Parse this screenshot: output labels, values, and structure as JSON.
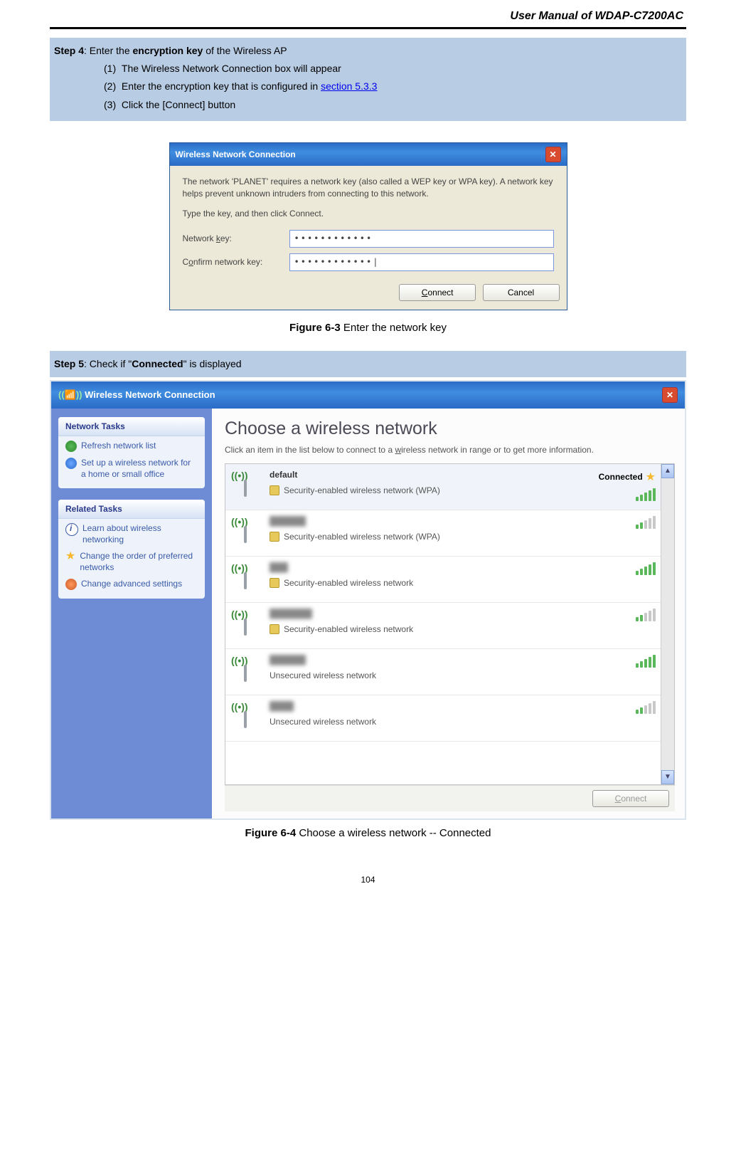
{
  "header": {
    "title": "User Manual of WDAP-C7200AC"
  },
  "step4": {
    "label": "Step 4",
    "text_a": ": Enter the ",
    "bold": "encryption key",
    "text_b": " of the Wireless AP",
    "items": [
      "The Wireless Network Connection box will appear",
      "Enter the encryption key that is configured in ",
      "Click the [Connect] button"
    ],
    "link": "section 5.3.3"
  },
  "dialog1": {
    "title": "Wireless Network Connection",
    "line1": "The network 'PLANET' requires a network key (also called a WEP key or WPA key). A network key helps prevent unknown intruders from connecting to this network.",
    "line2": "Type the key, and then click Connect.",
    "label_key": "Network key:",
    "label_confirm": "Confirm network key:",
    "key_value": "••••••••••••",
    "confirm_value": "••••••••••••|",
    "connect": "Connect",
    "cancel": "Cancel"
  },
  "caption1": {
    "bold": "Figure 6-3",
    "text": " Enter the network key"
  },
  "step5": {
    "label": "Step 5",
    "text_a": ": Check if \"",
    "bold": "Connected",
    "text_b": "\" is displayed"
  },
  "win2": {
    "title": "Wireless Network Connection",
    "sidebar": {
      "panel1_title": "Network Tasks",
      "panel1_items": [
        "Refresh network list",
        "Set up a wireless network for a home or small office"
      ],
      "panel2_title": "Related Tasks",
      "panel2_items": [
        "Learn about wireless networking",
        "Change the order of preferred networks",
        "Change advanced settings"
      ]
    },
    "main": {
      "heading": "Choose a wireless network",
      "desc": "Click an item in the list below to connect to a wireless network in range or to get more information.",
      "connect_btn": "Connect",
      "networks": [
        {
          "name": "default",
          "status": "Connected",
          "star": true,
          "sub": "Security-enabled wireless network (WPA)",
          "signal": 5,
          "lock": true,
          "blur": false
        },
        {
          "name": "██████",
          "sub": "Security-enabled wireless network (WPA)",
          "signal": 2,
          "lock": true,
          "blur": true
        },
        {
          "name": "███",
          "sub": "Security-enabled wireless network",
          "signal": 5,
          "lock": true,
          "blur": true
        },
        {
          "name": "███████",
          "sub": "Security-enabled wireless network",
          "signal": 2,
          "lock": true,
          "blur": true
        },
        {
          "name": "██████",
          "sub": "Unsecured wireless network",
          "signal": 5,
          "lock": false,
          "blur": true
        },
        {
          "name": "████",
          "sub": "Unsecured wireless network",
          "signal": 2,
          "lock": false,
          "blur": true
        }
      ]
    }
  },
  "caption2": {
    "bold": "Figure 6-4",
    "text": " Choose a wireless network -- Connected"
  },
  "page_number": "104"
}
